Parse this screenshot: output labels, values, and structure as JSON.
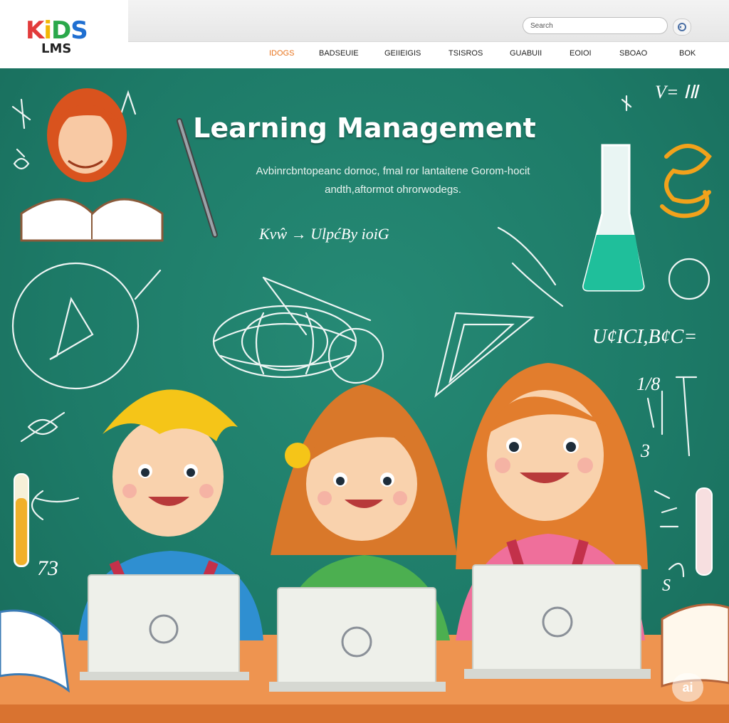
{
  "header": {
    "logo_kids": [
      "K",
      "i",
      "D",
      "S"
    ],
    "logo_lms": "LMS",
    "search": {
      "value": "Search"
    },
    "nav": [
      "IDOGS",
      "BADSEUIE",
      "GEIIEIGIS",
      "TSISROS",
      "GUABUII",
      "EOIOI",
      "SBOAO",
      "BOK"
    ],
    "active_nav": 0
  },
  "hero": {
    "title": "Learning Management",
    "subtitle_line1": "Avbinrcbntopeanc dornoc, fmal ror lantaitene Gorom-hocit",
    "subtitle_line2": "andth,aftormot ohrorwodegs."
  },
  "chalk": {
    "top_right": "V= ⅠⅡ",
    "formula_mid": "Kvŵ  →  UlpćBy  ioiG",
    "formula_right": "U¢ICI,B¢C=",
    "fraction": "1/8",
    "num_left": "73",
    "num_right_a": "3",
    "num_right_b": "S"
  },
  "badge": "ai",
  "colors": {
    "board": "#1f7d6a",
    "accent_nav": "#e8731c",
    "desk": "#ee9450",
    "chalk": "#ffffff"
  }
}
